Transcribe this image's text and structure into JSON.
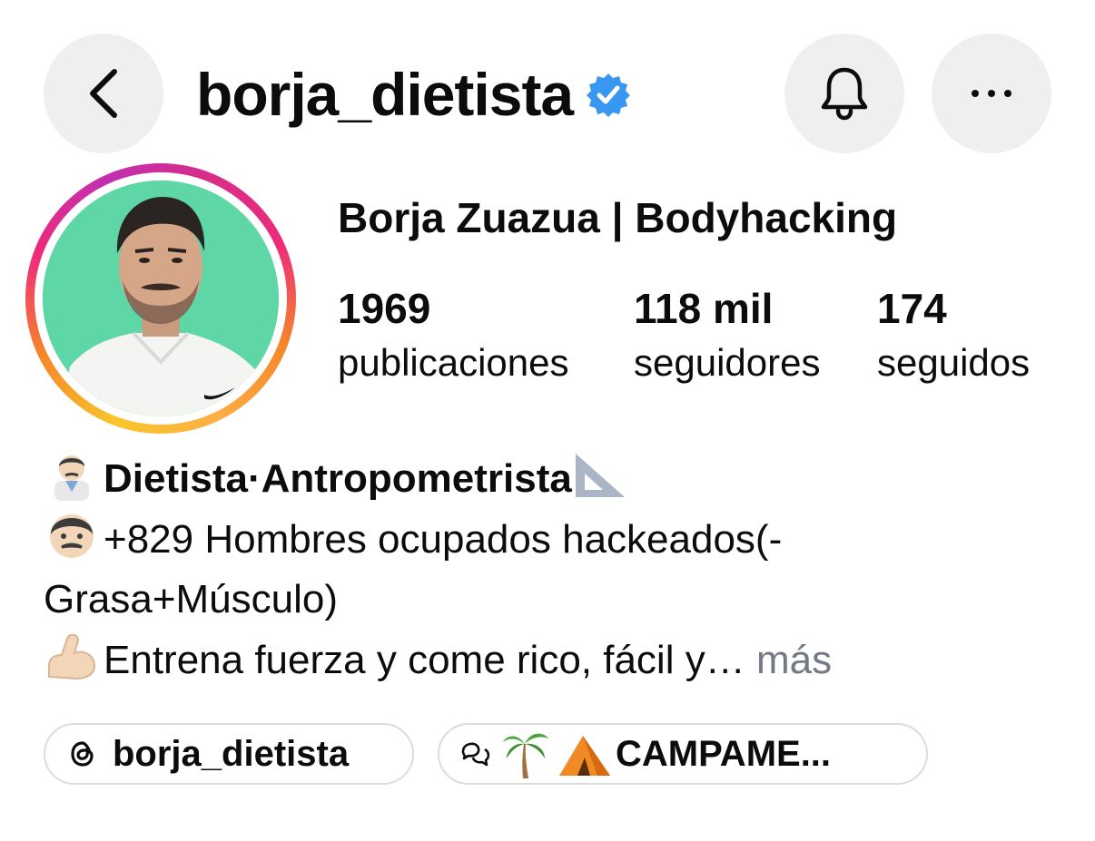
{
  "header": {
    "username": "borja_dietista",
    "back_icon": "chevron-left-icon",
    "verified_icon": "verified-badge-icon",
    "bell_icon": "bell-icon",
    "more_icon": "more-horizontal-icon"
  },
  "profile": {
    "display_name": "Borja Zuazua | Bodyhacking",
    "stats": [
      {
        "value": "1969",
        "label": "publicaciones"
      },
      {
        "value": "118 mil",
        "label": "seguidores"
      },
      {
        "value": "174",
        "label": "seguidos"
      }
    ]
  },
  "bio": {
    "line1": "Dietista·Antropometrista",
    "line2a": "+829 Hombres ocupados hackeados(-",
    "line2b": "Grasa+Músculo)",
    "line3": "Entrena fuerza y come rico, fácil y…",
    "more_label": " más"
  },
  "links": {
    "threads_label": "borja_dietista",
    "channel_label": "CAMPAME..."
  },
  "colors": {
    "verified": "#3897f0",
    "muted": "#737a86",
    "avatar_bg": "#5ed6a5"
  }
}
